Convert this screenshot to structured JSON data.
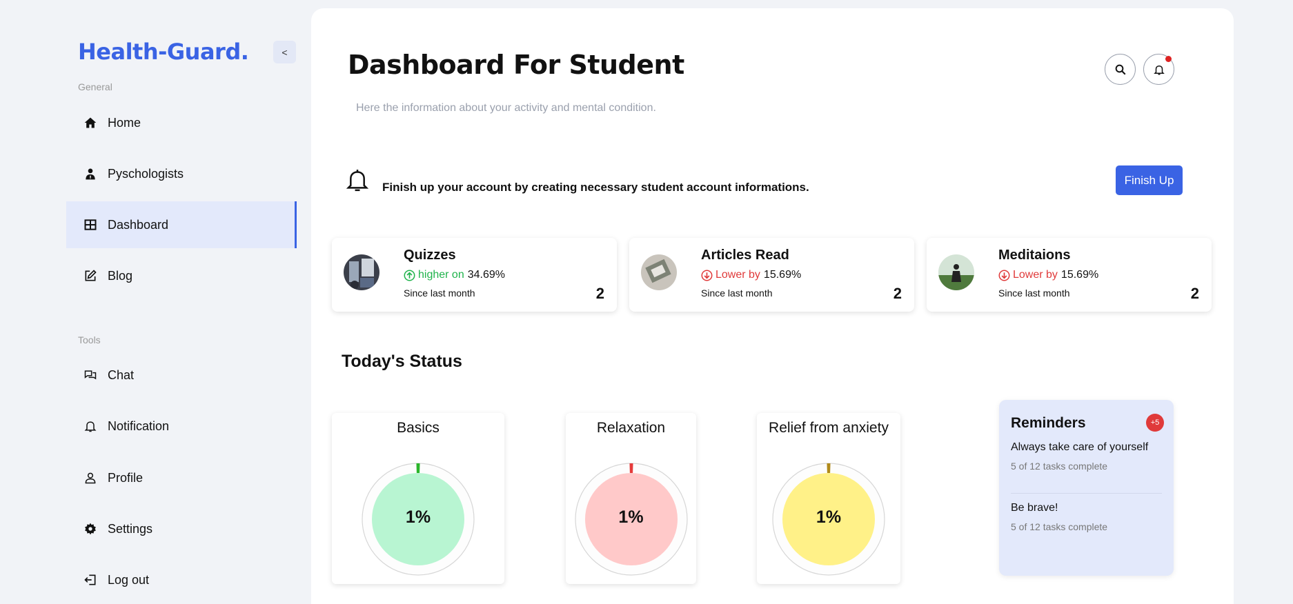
{
  "sidebar": {
    "brand": "Health-Guard.",
    "collapse_label": "<",
    "general_label": "General",
    "tools_label": "Tools",
    "general_items": [
      {
        "label": "Home",
        "icon": "home-icon"
      },
      {
        "label": "Pyschologists",
        "icon": "psychologist-icon"
      },
      {
        "label": "Dashboard",
        "icon": "dashboard-icon",
        "active": true
      },
      {
        "label": "Blog",
        "icon": "edit-icon"
      }
    ],
    "tool_items": [
      {
        "label": "Chat",
        "icon": "chat-icon"
      },
      {
        "label": "Notification",
        "icon": "bell-icon"
      },
      {
        "label": "Profile",
        "icon": "user-icon"
      },
      {
        "label": "Settings",
        "icon": "gear-icon"
      },
      {
        "label": "Log out",
        "icon": "logout-icon"
      }
    ]
  },
  "header": {
    "title": "Dashboard For Student",
    "subtitle": "Here the information about your activity and mental condition."
  },
  "banner": {
    "text": "Finish up your account by creating necessary student account informations.",
    "button_label": "Finish Up"
  },
  "stats": [
    {
      "title": "Quizzes",
      "trend_word": "higher on",
      "trend": "up",
      "percent": "34.69%",
      "since": "Since last month",
      "count": "2"
    },
    {
      "title": "Articles Read",
      "trend_word": "Lower by",
      "trend": "down",
      "percent": "15.69%",
      "since": "Since last month",
      "count": "2"
    },
    {
      "title": "Meditaions",
      "trend_word": "Lower by",
      "trend": "down",
      "percent": "15.69%",
      "since": "Since last month",
      "count": "2"
    }
  ],
  "today": {
    "title": "Today's Status",
    "gauges": [
      {
        "label": "Basics",
        "value": "1%",
        "fraction": 0.01,
        "fill": "#b8f5d2",
        "tick": "#2bb52b"
      },
      {
        "label": "Relaxation",
        "value": "1%",
        "fraction": 0.01,
        "fill": "#ffc9c9",
        "tick": "#e53b3b"
      },
      {
        "label": "Relief from anxiety",
        "value": "1%",
        "fraction": 0.01,
        "fill": "#fff188",
        "tick": "#b08a1a"
      }
    ]
  },
  "reminders": {
    "title": "Reminders",
    "badge": "+5",
    "items": [
      {
        "title": "Always take care of yourself",
        "sub": "5 of 12 tasks complete"
      },
      {
        "title": "Be brave!",
        "sub": "5 of 12 tasks complete"
      }
    ]
  },
  "colors": {
    "accent": "#3a63e4",
    "up": "#1fb34b",
    "down": "#e03a3a",
    "notif_dot": "#d22222"
  }
}
